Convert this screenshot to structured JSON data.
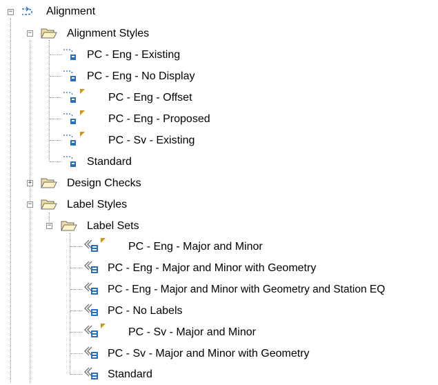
{
  "tree": {
    "root_label": "Alignment",
    "alignment_styles": {
      "label": "Alignment Styles",
      "items": [
        "PC - Eng - Existing",
        "PC - Eng - No Display",
        "PC - Eng - Offset",
        "PC - Eng - Proposed",
        "PC - Sv - Existing",
        "Standard"
      ]
    },
    "design_checks": {
      "label": "Design Checks"
    },
    "label_styles": {
      "label": "Label Styles",
      "label_sets": {
        "label": "Label Sets",
        "items": [
          "PC - Eng - Major and Minor",
          "PC - Eng - Major and Minor with Geometry",
          "PC - Eng - Major and Minor with Geometry and Station EQ",
          "PC - No Labels",
          "PC - Sv - Major and Minor",
          "PC - Sv - Major and Minor with Geometry",
          "Standard"
        ]
      }
    },
    "expand_glyphs": {
      "collapsed": "+",
      "expanded": "−"
    },
    "colors": {
      "folder_fill": "#f2dc9b",
      "style_icon": "#2a6fb8",
      "modified_flag": "#c8961e",
      "tree_lines": "#9a9a9a"
    }
  }
}
